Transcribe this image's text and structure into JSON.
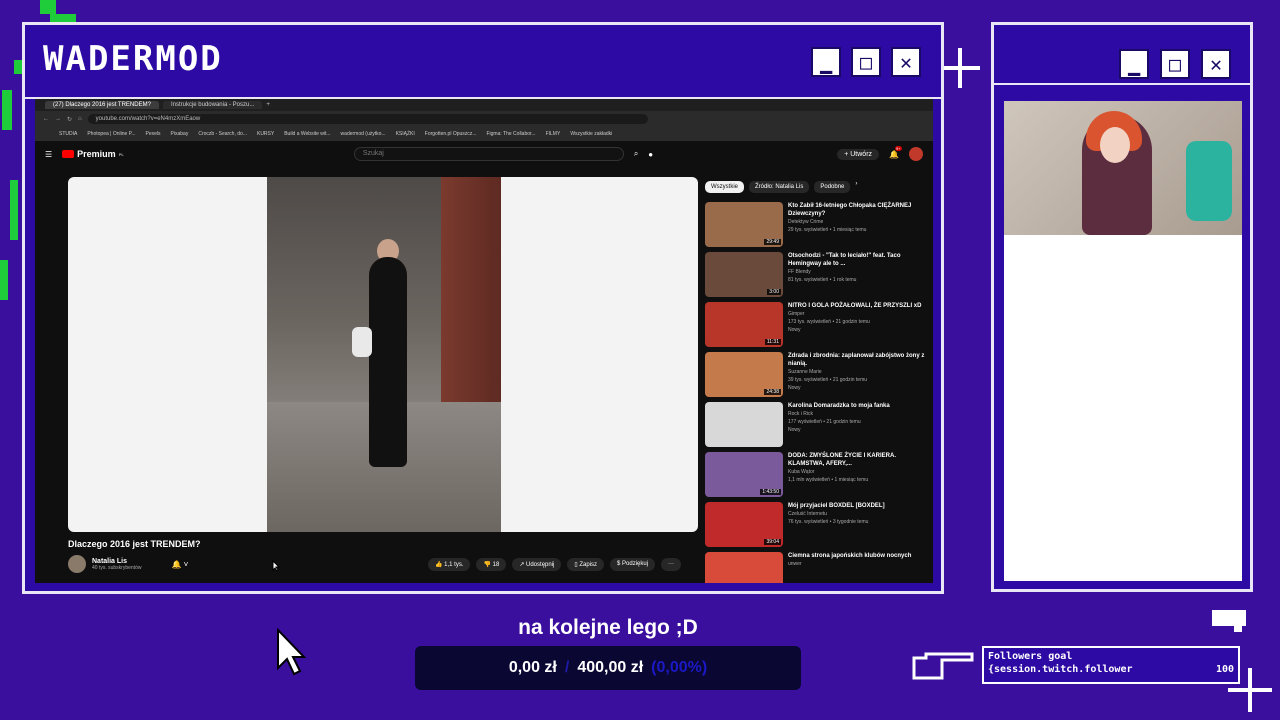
{
  "main_window": {
    "title": "WADERMOD",
    "controls": {
      "minimize": "▁",
      "maximize": "□",
      "close": "✕"
    }
  },
  "cam_window": {
    "controls": {
      "minimize": "▁",
      "maximize": "□",
      "close": "✕"
    }
  },
  "browser": {
    "tabs": [
      "(27) Dlaczego 2016 jest TRENDEM?",
      "Instrukcje budowania - Poszu..."
    ],
    "address": "youtube.com/watch?v=eN4mzXmEaow",
    "bookmarks": [
      "STUDIA",
      "Photopea | Online P...",
      "Pexels",
      "Pixabay",
      "Croczb - Search, do...",
      "KURSY",
      "Build a Website wit...",
      "wadermod (użytko...",
      "KSIĄŻKI",
      "Forgotten.pl Opuszcz...",
      "Figma: The Collabor...",
      "FILMY",
      "Wszystkie zakładki"
    ]
  },
  "youtube": {
    "logo": "Premium",
    "region": "PL",
    "search_placeholder": "Szukaj",
    "create_label": "Utwórz",
    "notif_count": "9+",
    "video_title": "Dlaczego 2016 jest TRENDEM?",
    "channel_name": "Natalia Lis",
    "channel_subs": "40 tys. subskrybentów",
    "actions": {
      "like": "1,1 tys.",
      "dislike": "18",
      "share": "Udostępnij",
      "save": "Zapisz",
      "thanks": "Podziękuj"
    },
    "chips": [
      "Wszystkie",
      "Źródło: Natalia Lis",
      "Podobne"
    ],
    "recommendations": [
      {
        "title": "Kto Zabił 16-letniego Chłopaka CIĘŻARNEJ Dziewczyny?",
        "channel": "Detektyw Crime",
        "meta": "29 tys. wyświetleń • 1 miesiąc temu",
        "duration": "29:49",
        "color": "#9a6b4a"
      },
      {
        "title": "Otsochodzi - \"Tak to leciało!\" feat. Taco Hemingway ale to ...",
        "channel": "FF Blendy",
        "meta": "81 tys. wyświetleń • 1 rok temu",
        "duration": "3:00",
        "color": "#6a4a3a"
      },
      {
        "title": "NITRO I GOLA POŻAŁOWALI, ŻE PRZYSZLI xD",
        "channel": "Gimper",
        "meta": "173 tys. wyświetleń • 21 godzin temu",
        "badge": "Nowy",
        "duration": "11:31",
        "color": "#b8352a"
      },
      {
        "title": "Zdrada i zbrodnia: zaplanował zabójstwo żony z nianią.",
        "channel": "Suzanne Marie",
        "meta": "39 tys. wyświetleń • 21 godzin temu",
        "badge": "Nowy",
        "duration": "24:38",
        "color": "#c47a4a"
      },
      {
        "title": "Karolina Domaradzka to moja fanka",
        "channel": "Rock i Rick",
        "meta": "177 wyświetleń • 21 godzin temu",
        "badge": "Nowy",
        "duration": "",
        "color": "#d8d8d8"
      },
      {
        "title": "DODA: ZMYŚLONE ŻYCIE I KARIERA. KLAMSTWA, AFERY,...",
        "channel": "Kuba Wątor",
        "meta": "1,1 mln wyświetleń • 1 miesiąc temu",
        "duration": "1:43:50",
        "color": "#7a5a9a"
      },
      {
        "title": "Mój przyjaciel BOXDEL [BOXDEL]",
        "channel": "Czeluść Internetu",
        "meta": "76 tys. wyświetleń • 3 tygodnie temu",
        "duration": "39:04",
        "color": "#c02a2a"
      },
      {
        "title": "Ciemna strona japońskich klubów nocnych",
        "channel": "unwer",
        "meta": "",
        "duration": "",
        "color": "#d84a3a"
      }
    ]
  },
  "donation_goal": {
    "title": "na kolejne lego ;D",
    "current": "0,00 zł",
    "separator": "/",
    "target": "400,00 zł",
    "percent": "(0,00%)",
    "progress": 0.0
  },
  "followers_goal": {
    "title": "Followers goal",
    "template": "{session.twitch.follower",
    "target": "100"
  }
}
